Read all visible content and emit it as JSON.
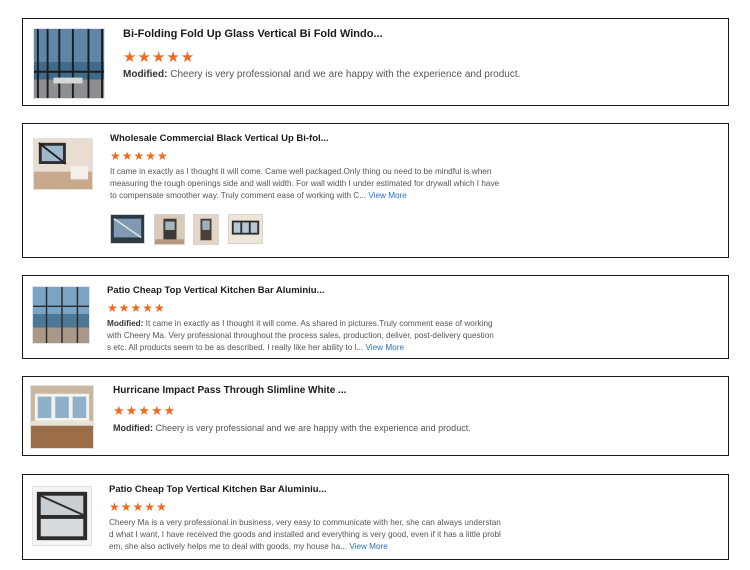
{
  "reviews": [
    {
      "title": "Bi-Folding Fold Up Glass Vertical Bi Fold Windo...",
      "stars": "★★★★★",
      "modified_label": "Modified:",
      "text": "Cheery is very professional and we are happy with the experience and product."
    },
    {
      "title": "Wholesale Commercial Black Vertical Up Bi-fol...",
      "stars": "★★★★★",
      "line1": "It came in exactly as I thought it will come.  Came well packaged.Only thing ou need to be mindful is when",
      "line2": "measuring the rough openings side and wall width. For wall width I under estimated for drywall which I have",
      "line3": "to compensate smoother way.  Truly comment ease of working with C...",
      "view_more": "View More"
    },
    {
      "title": "Patio Cheap Top Vertical Kitchen Bar Aluminiu...",
      "stars": "★★★★★",
      "modified_label": "Modified:",
      "line1": "It came in exactly as I thought it will come. As shared in pictures.Truly comment ease of working",
      "line2": "with Cheery Ma. Very professional throughout the process sales, production, deliver, post-delivery question",
      "line3": "s etc. All products seem to be as described. I really like her ability to l...",
      "view_more": "View More"
    },
    {
      "title": "Hurricane Impact Pass Through Slimline White ...",
      "stars": "★★★★★",
      "modified_label": "Modified:",
      "text": "Cheery is very professional and we are happy with the experience and product."
    },
    {
      "title": "Patio Cheap Top Vertical Kitchen Bar Aluminiu...",
      "stars": "★★★★★",
      "line1": "Cheery Ma is a very professional in business, very easy to communicate with her, she can always understan",
      "line2": "d what I want, I have received the goods and installed and everything is very good, even if it has a little probl",
      "line3": "em, she also actively helps me to deal with goods, my house ha...",
      "view_more": "View More"
    }
  ],
  "colors": {
    "star": "#ee6a1f",
    "link": "#2a70c9",
    "border": "#1a1a1a"
  }
}
